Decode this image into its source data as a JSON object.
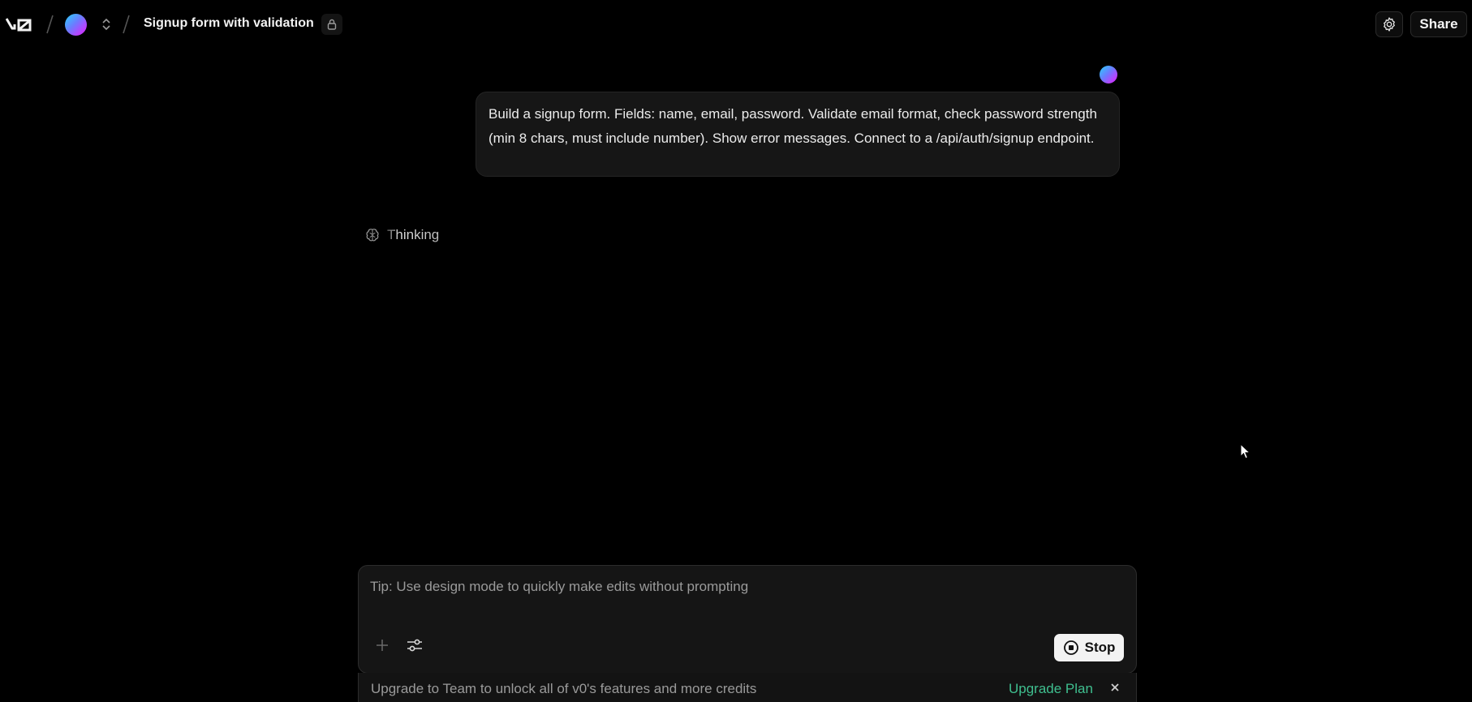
{
  "header": {
    "logo_label": "v0",
    "project_title": "Signup form with validation",
    "share_label": "Share"
  },
  "chat": {
    "user_message": "Build a signup form. Fields: name, email, password. Validate email format, check password strength (min 8 chars, must include number). Show error messages. Connect to a /api/auth/signup endpoint.",
    "status_text": "Thinking"
  },
  "composer": {
    "placeholder": "Tip: Use design mode to quickly make edits without prompting",
    "stop_label": "Stop"
  },
  "banner": {
    "text": "Upgrade to Team to unlock all of v0's features and more credits",
    "link_label": "Upgrade Plan"
  },
  "colors": {
    "background": "#000000",
    "accent_link": "#3fbf8f",
    "stop_button_bg": "#f3f3f3"
  },
  "icons": [
    "v0-logo-icon",
    "project-avatar",
    "chevron-up-down-icon",
    "lock-icon",
    "gear-icon",
    "user-avatar",
    "brain-icon",
    "plus-icon",
    "sliders-icon",
    "stop-circle-icon",
    "close-icon",
    "mouse-cursor"
  ]
}
